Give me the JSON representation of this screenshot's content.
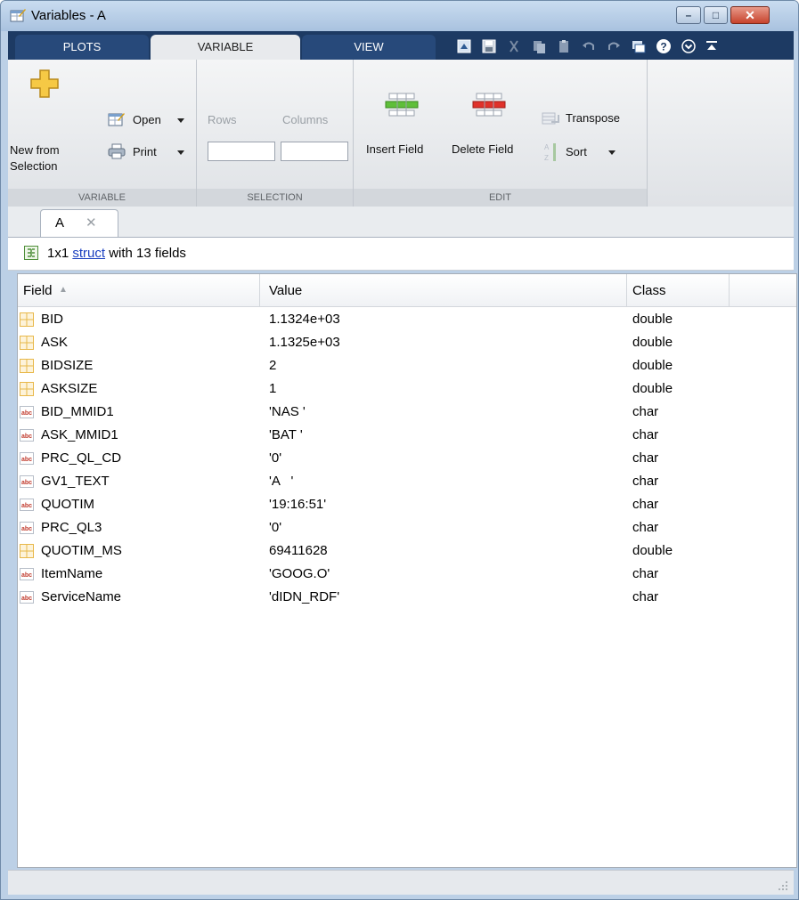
{
  "window": {
    "title": "Variables - A",
    "controls": {
      "minimize": "–",
      "maximize": "□",
      "close": "✕"
    }
  },
  "ribbon_tabs": [
    "PLOTS",
    "VARIABLE",
    "VIEW"
  ],
  "ribbon": {
    "variable": {
      "new_from_selection_line1": "New from",
      "new_from_selection_line2": "Selection",
      "open": "Open",
      "print": "Print",
      "section_label": "VARIABLE"
    },
    "selection": {
      "rows": "Rows",
      "columns": "Columns",
      "rows_value": "",
      "columns_value": "",
      "section_label": "SELECTION"
    },
    "edit": {
      "insert_field": "Insert Field",
      "delete_field": "Delete Field",
      "transpose": "Transpose",
      "sort": "Sort",
      "section_label": "EDIT"
    }
  },
  "document_tab": {
    "label": "A",
    "close": "✕"
  },
  "info": {
    "prefix": "1x1 ",
    "link": "struct",
    "suffix": " with 13 fields"
  },
  "table": {
    "columns": [
      "Field",
      "Value",
      "Class"
    ],
    "sort_indicator": "▲",
    "rows": [
      {
        "icon": "numeric",
        "field": "BID",
        "value": "1.1324e+03",
        "class": "double"
      },
      {
        "icon": "numeric",
        "field": "ASK",
        "value": "1.1325e+03",
        "class": "double"
      },
      {
        "icon": "numeric",
        "field": "BIDSIZE",
        "value": "2",
        "class": "double"
      },
      {
        "icon": "numeric",
        "field": "ASKSIZE",
        "value": "1",
        "class": "double"
      },
      {
        "icon": "char",
        "field": "BID_MMID1",
        "value": "'NAS '",
        "class": "char"
      },
      {
        "icon": "char",
        "field": "ASK_MMID1",
        "value": "'BAT '",
        "class": "char"
      },
      {
        "icon": "char",
        "field": "PRC_QL_CD",
        "value": "'0'",
        "class": "char"
      },
      {
        "icon": "char",
        "field": "GV1_TEXT",
        "value": "'A   '",
        "class": "char"
      },
      {
        "icon": "char",
        "field": "QUOTIM",
        "value": "'19:16:51'",
        "class": "char"
      },
      {
        "icon": "char",
        "field": "PRC_QL3",
        "value": "'0'",
        "class": "char"
      },
      {
        "icon": "numeric",
        "field": "QUOTIM_MS",
        "value": "69411628",
        "class": "double"
      },
      {
        "icon": "char",
        "field": "ItemName",
        "value": "'GOOG.O'",
        "class": "char"
      },
      {
        "icon": "char",
        "field": "ServiceName",
        "value": "'dIDN_RDF'",
        "class": "char"
      }
    ]
  },
  "colors": {
    "tabstrip": "#1d3a63",
    "numeric_icon": "#e8b84a",
    "char_icon": "#c0392b",
    "link": "#1a3fbf"
  }
}
